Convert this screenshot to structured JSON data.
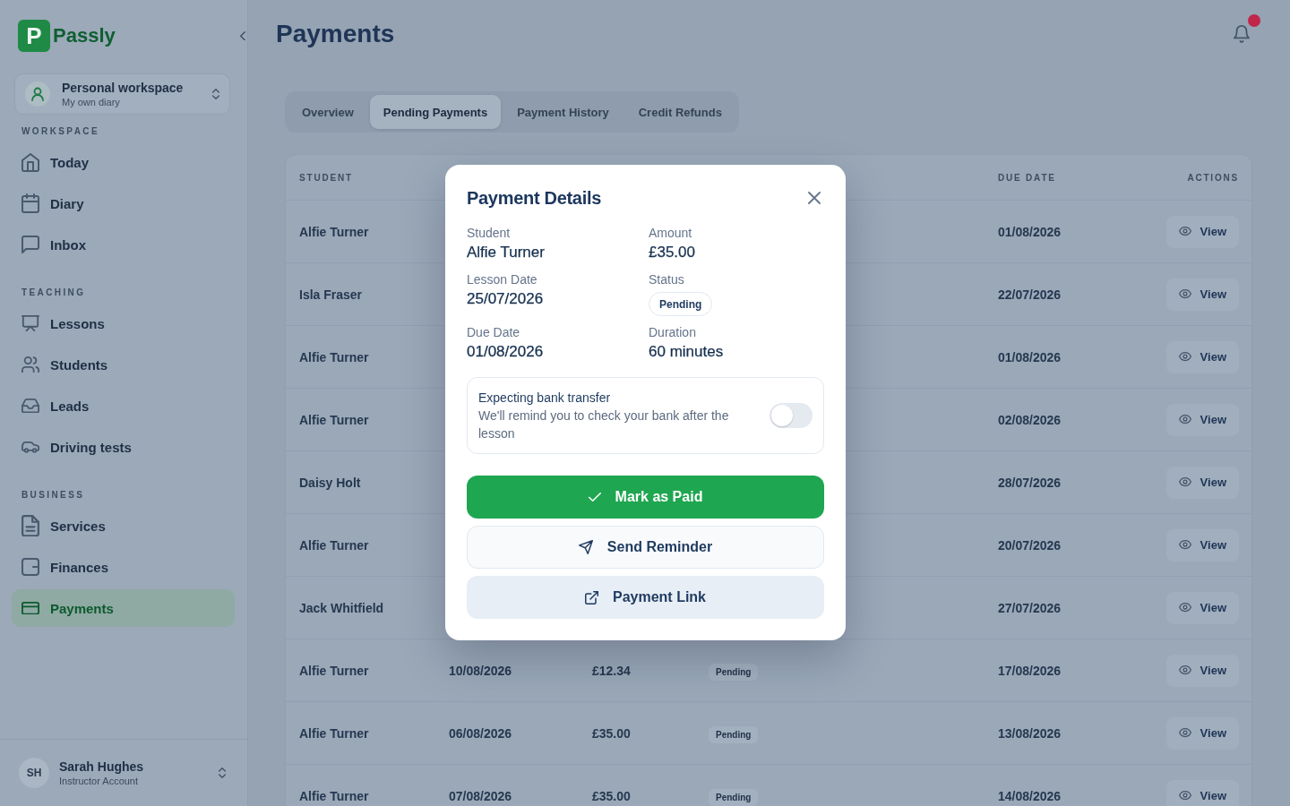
{
  "sidebar": {
    "logo": {
      "mark": "P",
      "name": "Passly"
    },
    "workspace": {
      "title": "Personal workspace",
      "subtitle": "My own diary"
    },
    "sections": [
      {
        "label": "WORKSPACE",
        "items": [
          {
            "label": "Today",
            "selected": false
          },
          {
            "label": "Diary",
            "selected": false
          },
          {
            "label": "Inbox",
            "selected": false
          }
        ]
      },
      {
        "label": "TEACHING",
        "items": [
          {
            "label": "Lessons",
            "selected": false
          },
          {
            "label": "Students",
            "selected": false
          },
          {
            "label": "Leads",
            "selected": false
          },
          {
            "label": "Driving tests",
            "selected": false
          }
        ]
      },
      {
        "label": "BUSINESS",
        "items": [
          {
            "label": "Services",
            "selected": false
          },
          {
            "label": "Finances",
            "selected": false
          },
          {
            "label": "Payments",
            "selected": true
          }
        ]
      }
    ],
    "user": {
      "initials": "SH",
      "name": "Sarah Hughes",
      "role": "Instructor Account"
    }
  },
  "header": {
    "title": "Payments",
    "notifications": {
      "unread": true
    }
  },
  "tabs": [
    {
      "label": "Overview",
      "selected": false
    },
    {
      "label": "Pending Payments",
      "selected": true
    },
    {
      "label": "Payment History",
      "selected": false
    },
    {
      "label": "Credit Refunds",
      "selected": false
    }
  ],
  "table": {
    "header": {
      "student": "STUDENT",
      "due_date": "DUE DATE",
      "actions": "ACTIONS"
    },
    "rows": [
      {
        "student": "Alfie Turner",
        "due_date": "01/08/2026",
        "action": "View"
      },
      {
        "student": "Isla Fraser",
        "due_date": "22/07/2026",
        "action": "View"
      },
      {
        "student": "Alfie Turner",
        "due_date": "01/08/2026",
        "action": "View"
      },
      {
        "student": "Alfie Turner",
        "due_date": "02/08/2026",
        "action": "View"
      },
      {
        "student": "Daisy Holt",
        "due_date": "28/07/2026",
        "action": "View"
      },
      {
        "student": "Alfie Turner",
        "due_date": "20/07/2026",
        "action": "View"
      },
      {
        "student": "Jack Whitfield",
        "due_date": "27/07/2026",
        "action": "View"
      },
      {
        "student": "Alfie Turner",
        "column_2": "10/08/2026",
        "column_3": "£12.34",
        "column_4": "Pending",
        "due_date": "17/08/2026",
        "action": "View"
      },
      {
        "student": "Alfie Turner",
        "column_2": "06/08/2026",
        "column_3": "£35.00",
        "column_4": "Pending",
        "due_date": "13/08/2026",
        "action": "View"
      },
      {
        "student": "Alfie Turner",
        "column_2": "07/08/2026",
        "column_3": "£35.00",
        "column_4": "Pending",
        "due_date": "14/08/2026",
        "action": "View"
      }
    ]
  },
  "modal": {
    "title": "Payment Details",
    "fields": [
      {
        "label": "Student",
        "value": "Alfie Turner",
        "kind": "text"
      },
      {
        "label": "Amount",
        "value": "£35.00",
        "kind": "text"
      },
      {
        "label": "Lesson Date",
        "value": "25/07/2026",
        "kind": "text"
      },
      {
        "label": "Status",
        "value": "Pending",
        "kind": "badge"
      },
      {
        "label": "Due Date",
        "value": "01/08/2026",
        "kind": "text"
      },
      {
        "label": "Duration",
        "value": "60 minutes",
        "kind": "text"
      }
    ],
    "bank_transfer": {
      "title": "Expecting bank transfer",
      "description": "We'll remind you to check your bank after the lesson",
      "on": false
    },
    "buttons": [
      {
        "label": "Mark as Paid",
        "kind": "primary"
      },
      {
        "label": "Send Reminder",
        "kind": "secondary"
      },
      {
        "label": "Payment Link",
        "kind": "tertiary"
      }
    ]
  }
}
